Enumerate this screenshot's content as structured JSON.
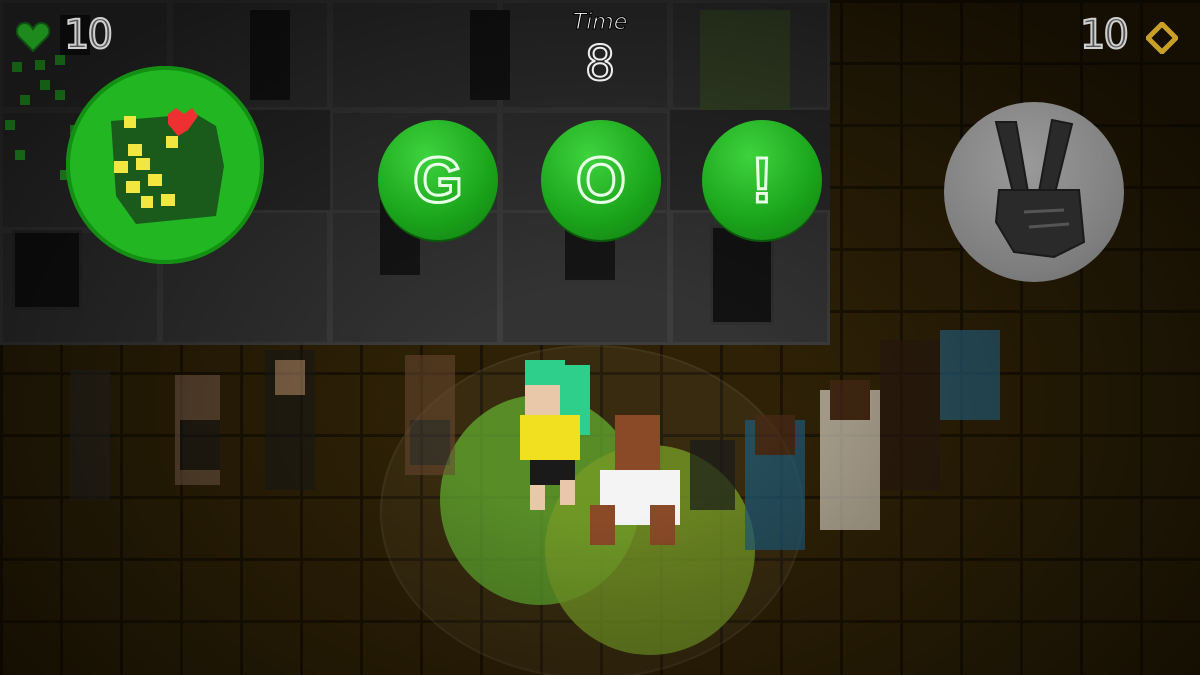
{
  "hud": {
    "lives_icon": "heart-icon",
    "lives": "10",
    "time_label": "Time",
    "time_value": "8",
    "score": "10",
    "score_icon": "diamond-icon"
  },
  "buttons": {
    "left_hand": "fist-icon",
    "go_letters": [
      "G",
      "O",
      "!"
    ],
    "right_hand": "peace-sign-icon"
  },
  "colors": {
    "go_green": "#1fb21f",
    "fist_green": "#22b622",
    "peace_grey": "#7f7f7f",
    "lives_heart": "#1e8a1e",
    "score_diamond": "#c8a028"
  }
}
